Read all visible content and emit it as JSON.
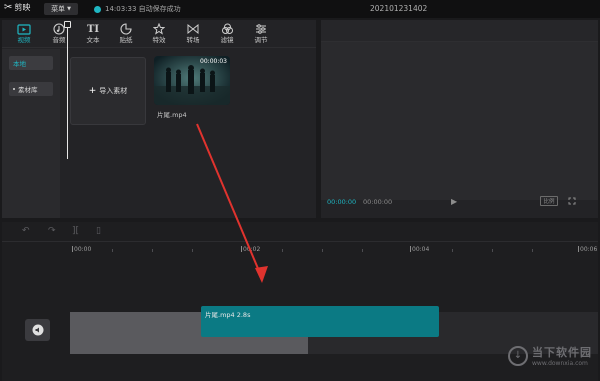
{
  "app": {
    "name": "剪映",
    "menu_label": "菜单",
    "status_text": "14:03:33 自动保存成功",
    "project_name": "202101231402"
  },
  "toolbar": {
    "tabs": [
      {
        "label": "视频",
        "icon": "video-icon"
      },
      {
        "label": "音频",
        "icon": "audio-icon"
      },
      {
        "label": "文本",
        "icon": "text-icon"
      },
      {
        "label": "贴纸",
        "icon": "sticker-icon"
      },
      {
        "label": "特效",
        "icon": "effects-icon"
      },
      {
        "label": "转场",
        "icon": "transition-icon"
      },
      {
        "label": "滤镜",
        "icon": "filter-icon"
      },
      {
        "label": "调节",
        "icon": "adjust-icon"
      }
    ]
  },
  "media": {
    "nav": [
      "本地",
      "素材库"
    ],
    "import_label": "导入素材",
    "clip": {
      "name": "片尾.mp4",
      "duration": "00:00:03"
    }
  },
  "preview": {
    "current_time": "00:00:00",
    "total_time": "00:00:00",
    "ratio_label": "比例"
  },
  "timeline": {
    "ticks": [
      "00:00",
      "00:02",
      "00:04",
      "00:06"
    ],
    "clip_label": "片尾.mp4   2.8s"
  },
  "watermark": {
    "name": "当下软件园",
    "url": "www.downxia.com"
  },
  "colors": {
    "accent": "#1fb7c3",
    "clip": "#0b7a84",
    "arrow": "#e0332e"
  }
}
